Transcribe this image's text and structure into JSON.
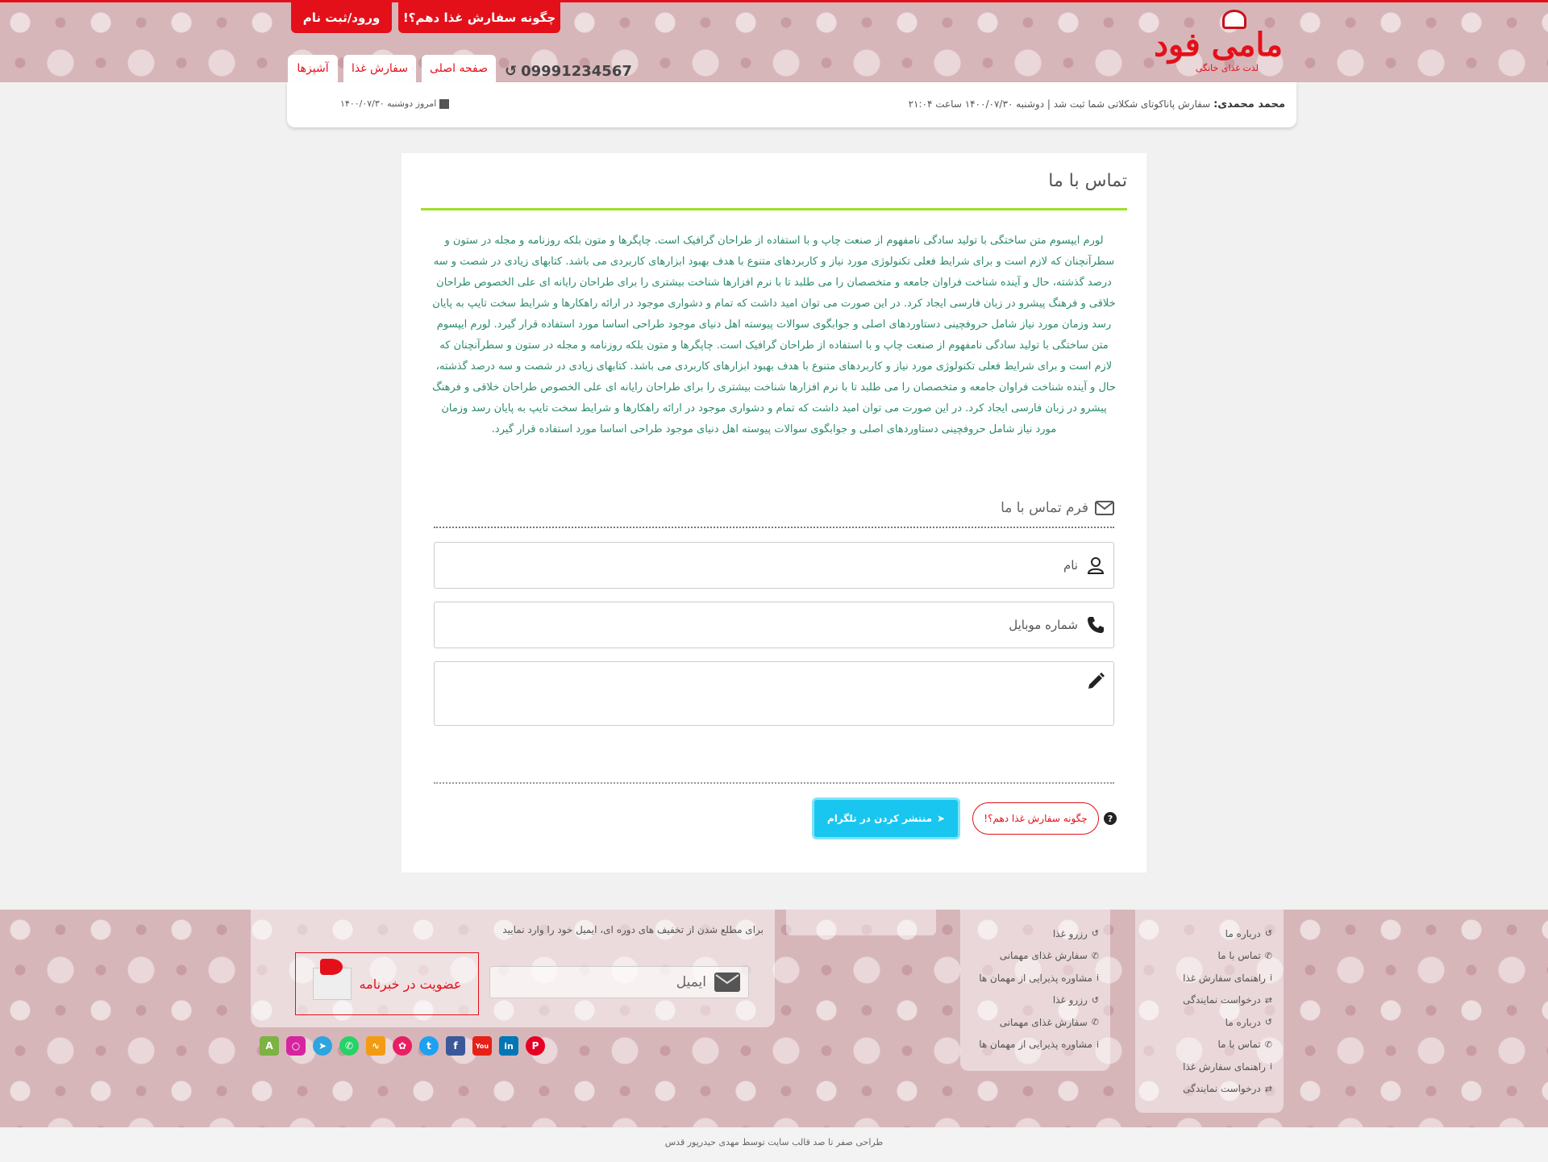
{
  "header": {
    "how_to_order": "چگونه سفارش غذا دهم؟!",
    "login_register": "ورود/ثبت نام",
    "logo_text": "مامی فود",
    "logo_sub": "لذت غذای خانگی",
    "phone": "09991234567",
    "nav": {
      "home": "صفحه اصلی",
      "order_food": "سفارش غذا",
      "chefs": "آشپزها"
    },
    "notice_user": "محمد محمدی:",
    "notice_text": "سفارش پاناکوتای شکلاتی شما ثبت شد | دوشنبه ۱۴۰۰/۰۷/۳۰ ساعت ۲۱:۰۴",
    "today": "امروز دوشنبه ۱۴۰۰/۰۷/۳۰"
  },
  "main": {
    "title": "تماس با ما",
    "lorem": "لورم ایپسوم متن ساختگی با تولید سادگی نامفهوم از صنعت چاپ و با استفاده از طراحان گرافیک است. چاپگرها و متون بلکه روزنامه و مجله در ستون و سطرآنچنان که لازم است و برای شرایط فعلی تکنولوژی مورد نیاز و کاربردهای متنوع با هدف بهبود ابزارهای کاربردی می باشد. کتابهای زیادی در شصت و سه درصد گذشته، حال و آینده شناخت فراوان جامعه و متخصصان را می طلبد تا با نرم افزارها شناخت بیشتری را برای طراحان رایانه ای علی الخصوص طراحان خلاقی و فرهنگ پیشرو در زبان فارسی ایجاد کرد. در این صورت می توان امید داشت که تمام و دشواری موجود در ارائه راهکارها و شرایط سخت تایپ به پایان رسد وزمان مورد نیاز شامل حروفچینی دستاوردهای اصلی و جوابگوی سوالات پیوسته اهل دنیای موجود طراحی اساسا مورد استفاده قرار گیرد. لورم ایپسوم متن ساختگی با تولید سادگی نامفهوم از صنعت چاپ و با استفاده از طراحان گرافیک است. چاپگرها و متون بلکه روزنامه و مجله در ستون و سطرآنچنان که لازم است و برای شرایط فعلی تکنولوژی مورد نیاز و کاربردهای متنوع با هدف بهبود ابزارهای کاربردی می باشد. کتابهای زیادی در شصت و سه درصد گذشته، حال و آینده شناخت فراوان جامعه و متخصصان را می طلبد تا با نرم افزارها شناخت بیشتری را برای طراحان رایانه ای علی الخصوص طراحان خلاقی و فرهنگ پیشرو در زبان فارسی ایجاد کرد. در این صورت می توان امید داشت که تمام و دشواری موجود در ارائه راهکارها و شرایط سخت تایپ به پایان رسد وزمان مورد نیاز شامل حروفچینی دستاوردهای اصلی و جوابگوی سوالات پیوسته اهل دنیای موجود طراحی اساسا مورد استفاده قرار گیرد.",
    "form_title": "فرم تماس با ما",
    "name_placeholder": "نام",
    "mobile_placeholder": "شماره موبایل",
    "how_to_order": "چگونه سفارش غذا دهم؟!",
    "share_telegram": "منتشر کردن در تلگرام"
  },
  "footer": {
    "col1": [
      "درباره ما",
      "تماس با ما",
      "راهنمای سفارش غذا",
      "درخواست نمایندگی",
      "درباره ما",
      "تماس با ما",
      "راهنمای سفارش غذا",
      "درخواست نمایندگی"
    ],
    "col2": [
      "رزرو غذا",
      "سفارش غذای مهمانی",
      "مشاوره پذیرایی از مهمان ها",
      "رزرو غذا",
      "سفارش غذای مهمانی",
      "مشاوره پذیرایی از مهمان ها"
    ],
    "newsletter_text": "برای مطلع شدن از تخفیف های دوره ای، ایمیل خود را وارد نمایید",
    "email_placeholder": "ایمیل",
    "subscribe": "عضویت در خبرنامه",
    "copyright": "طراحی صفر تا صد قالب سایت توسط مهدی حیدرپور قدس"
  },
  "colors": {
    "brand_red": "#e3101a",
    "accent_green": "#9ee028",
    "telegram_blue": "#19c6f0",
    "body_text_green": "#2a8a6e"
  }
}
